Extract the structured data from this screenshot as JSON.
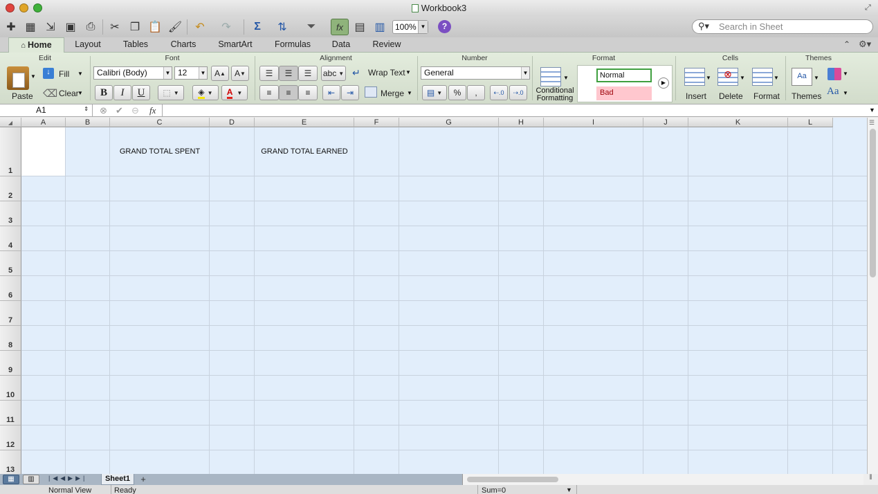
{
  "window": {
    "title": "Workbook3"
  },
  "toolbar": {
    "zoom": "100%",
    "search_placeholder": "Search in Sheet"
  },
  "ribbon_tabs": [
    "Home",
    "Layout",
    "Tables",
    "Charts",
    "SmartArt",
    "Formulas",
    "Data",
    "Review"
  ],
  "ribbon": {
    "edit": {
      "title": "Edit",
      "paste": "Paste",
      "fill": "Fill",
      "clear": "Clear"
    },
    "font": {
      "title": "Font",
      "name": "Calibri (Body)",
      "size": "12",
      "bold": "B",
      "italic": "I",
      "underline": "U",
      "grow": "A",
      "shrink": "A",
      "color": "A"
    },
    "alignment": {
      "title": "Alignment",
      "abc": "abc",
      "wrap": "Wrap Text",
      "merge": "Merge"
    },
    "number": {
      "title": "Number",
      "format": "General",
      "percent": "%",
      "comma": ","
    },
    "format": {
      "title": "Format",
      "cf_line1": "Conditional",
      "cf_line2": "Formatting",
      "style_normal": "Normal",
      "style_bad": "Bad"
    },
    "cells": {
      "title": "Cells",
      "insert": "Insert",
      "delete": "Delete",
      "format": "Format"
    },
    "themes": {
      "title": "Themes",
      "themes": "Themes",
      "fonts": "Aa"
    }
  },
  "formula_bar": {
    "name_box": "A1",
    "fx": "fx",
    "value": ""
  },
  "columns": [
    "A",
    "B",
    "C",
    "D",
    "E",
    "F",
    "G",
    "H",
    "I",
    "J",
    "K",
    "L"
  ],
  "rows": [
    "1",
    "2",
    "3",
    "4",
    "5",
    "6",
    "7",
    "8",
    "9",
    "10",
    "11",
    "12",
    "13"
  ],
  "cells": {
    "C1": "GRAND TOTAL SPENT",
    "E1": "GRAND TOTAL EARNED"
  },
  "sheets": [
    "Sheet1"
  ],
  "status": {
    "view": "Normal View",
    "state": "Ready",
    "sum": "Sum=0"
  },
  "colors": {
    "grid_bg": "#e2eefb",
    "ribbon_bg": "#dfe9d9",
    "bad_style": "#ffc7ce",
    "normal_border": "#3f9f3f"
  }
}
